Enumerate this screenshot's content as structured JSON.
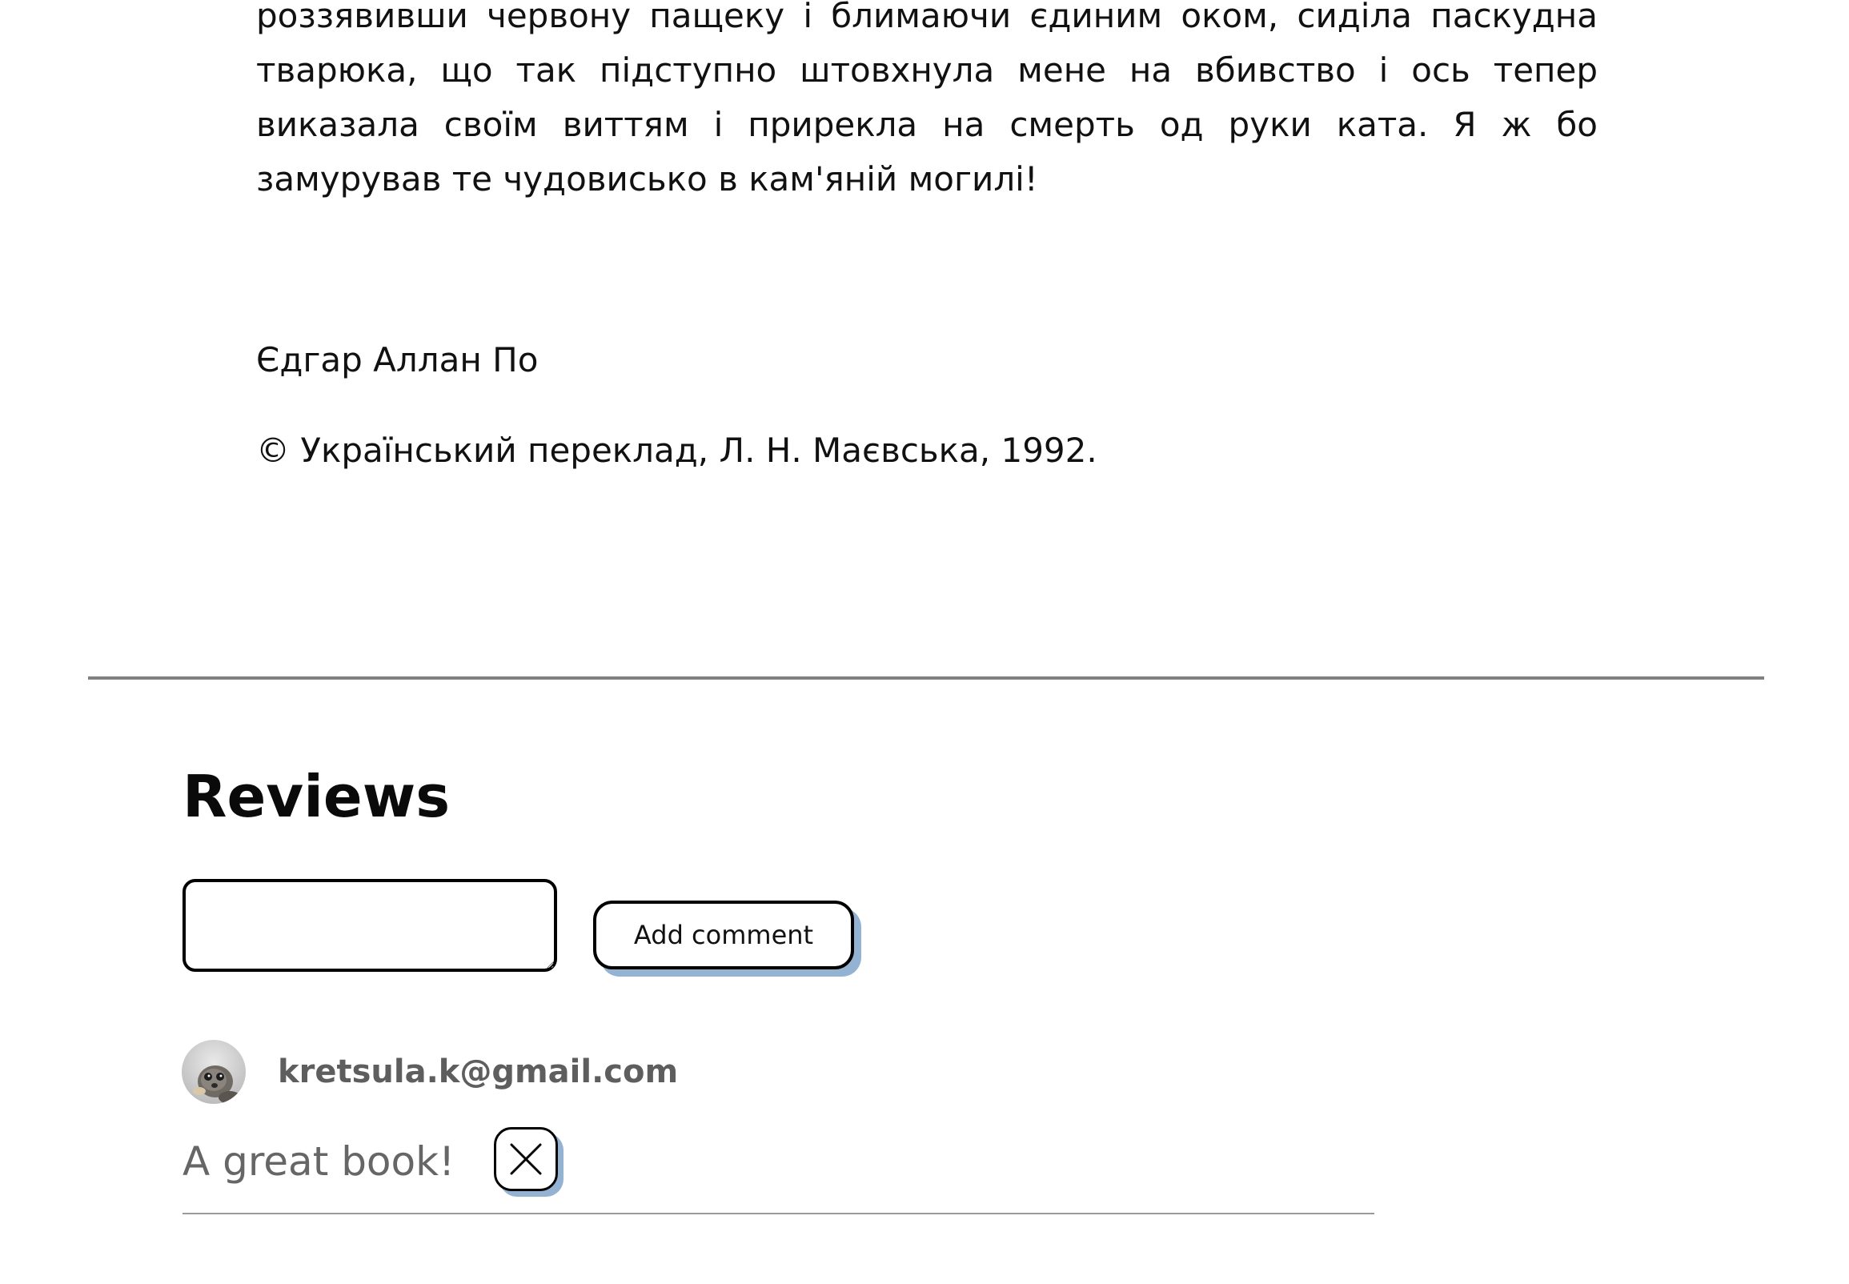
{
  "story": {
    "text": "роззявивши червону пащеку і блимаючи єдиним оком, сиділа паскудна тварюка, що так підступно штовхнула мене на вбивство і ось тепер виказала своїм виттям і прирекла на смерть од руки ката. Я ж бо замурував те чудовисько в кам'яній могилі!",
    "author": "Єдгар Аллан По",
    "copyright": "© Український переклад, Л. Н. Маєвська, 1992."
  },
  "reviews": {
    "title": "Reviews",
    "input_value": "",
    "add_button_label": "Add comment",
    "comments": [
      {
        "user": "kretsula.k@gmail.com",
        "avatar_icon": "avatar-photo",
        "text": "A great book!",
        "delete_icon": "close-icon"
      }
    ]
  },
  "colors": {
    "button_shadow": "#94b3d3",
    "divider": "#808080",
    "email_text": "#5e5e5e",
    "comment_text": "#666666"
  }
}
